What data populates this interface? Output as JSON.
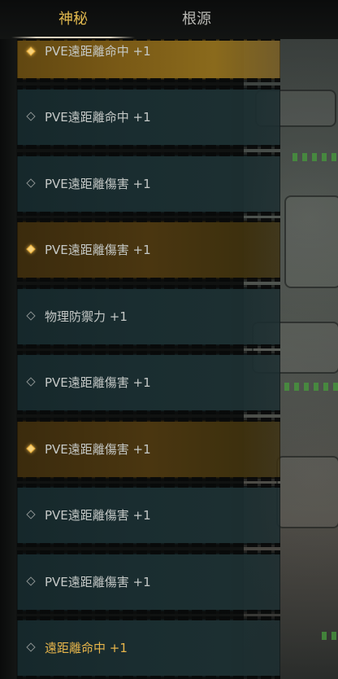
{
  "tabs": [
    {
      "label": "神秘",
      "active": true
    },
    {
      "label": "根源",
      "active": false
    }
  ],
  "items": [
    {
      "label": "PVE遠距離命中 +1",
      "icon": "diamond-gold-icon",
      "style": "gold-bright",
      "cut": true
    },
    {
      "label": "PVE遠距離命中 +1",
      "icon": "diamond-outline-icon",
      "style": "normal"
    },
    {
      "label": "PVE遠距離傷害 +1",
      "icon": "diamond-outline-icon",
      "style": "normal"
    },
    {
      "label": "PVE遠距離傷害 +1",
      "icon": "diamond-gold-icon",
      "style": "gold"
    },
    {
      "label": "物理防禦力 +1",
      "icon": "diamond-outline-icon",
      "style": "normal"
    },
    {
      "label": "PVE遠距離傷害 +1",
      "icon": "diamond-outline-icon",
      "style": "normal"
    },
    {
      "label": "PVE遠距離傷害 +1",
      "icon": "diamond-gold-icon",
      "style": "gold"
    },
    {
      "label": "PVE遠距離傷害 +1",
      "icon": "diamond-outline-icon",
      "style": "normal"
    },
    {
      "label": "PVE遠距離傷害 +1",
      "icon": "diamond-outline-icon",
      "style": "normal"
    },
    {
      "label": "遠距離命中 +1",
      "icon": "diamond-outline-icon",
      "style": "normal-highlight"
    }
  ],
  "colors": {
    "accent_gold": "#e0b84e",
    "text_normal": "#c5c9c7",
    "item_normal_bg": "#1a2d30",
    "item_gold_bg": "#4a3610"
  }
}
